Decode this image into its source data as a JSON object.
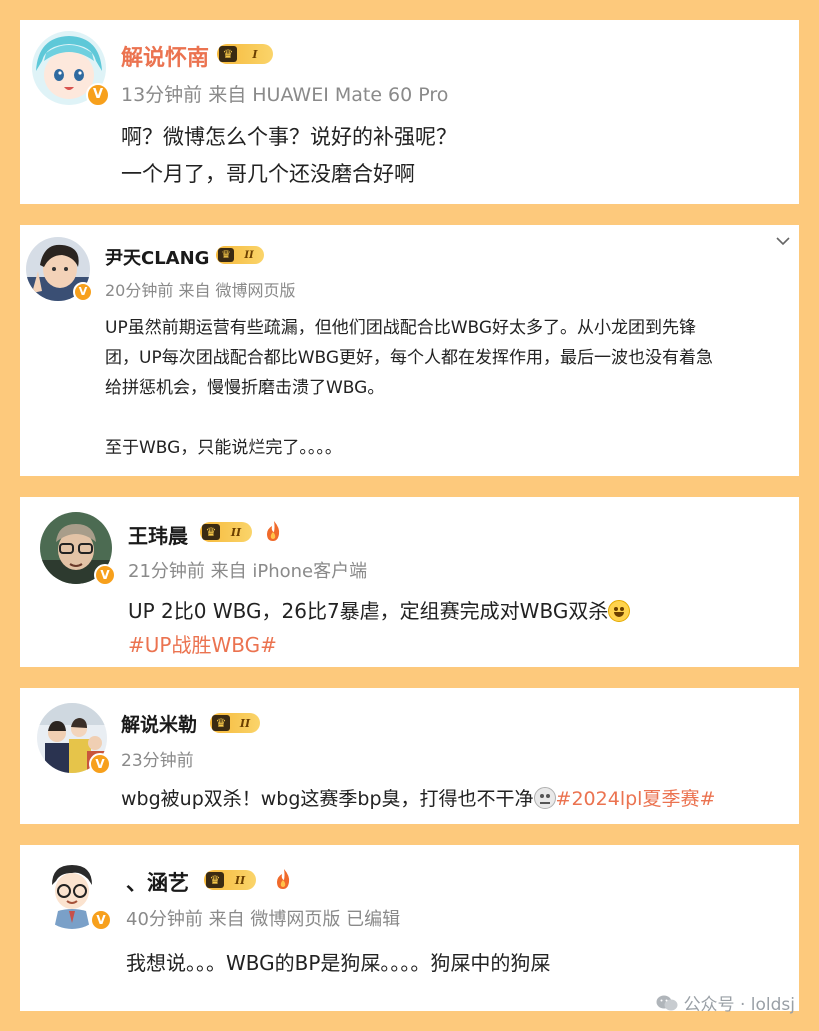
{
  "colors": {
    "background": "#fdc97c",
    "card": "#ffffff",
    "name_highlight": "#eb7350",
    "hashtag": "#eb7350",
    "meta": "#8a8a8a",
    "verified_badge": "#f7a01c"
  },
  "comments": [
    {
      "name": "解说怀南",
      "level_badge": "I",
      "meta": "13分钟前 来自 HUAWEI Mate 60 Pro",
      "lines": [
        "啊？微博怎么个事？说好的补强呢？",
        "一个月了，哥几个还没磨合好啊"
      ]
    },
    {
      "name": "尹天CLANG",
      "level_badge": "II",
      "meta": "20分钟前 来自 微博网页版",
      "lines": [
        "UP虽然前期运营有些疏漏，但他们团战配合比WBG好太多了。从小龙团到先锋",
        "团，UP每次团战配合都比WBG更好，每个人都在发挥作用，最后一波也没有着急",
        "给拼惩机会，慢慢折磨击溃了WBG。",
        "至于WBG，只能说烂完了。。。。"
      ],
      "collapse_icon": "chevron-down-icon"
    },
    {
      "name": "王玮晨",
      "level_badge": "II",
      "meta": "21分钟前 来自 iPhone客户端",
      "lines": [
        "UP 2比0 WBG，26比7暴虐，定组赛完成对WBG双杀"
      ],
      "hashtag": "#UP战胜WBG#"
    },
    {
      "name": "解说米勒",
      "level_badge": "II",
      "meta": "23分钟前",
      "line_prefix": "wbg被up双杀！wbg这赛季bp臭，打得也不干净",
      "hashtag": "#2024lpl夏季赛#"
    },
    {
      "name": "、涵艺",
      "level_badge": "II",
      "meta": "40分钟前 来自 微博网页版 已编辑",
      "lines": [
        "我想说。。。WBG的BP是狗屎。。。。狗屎中的狗屎"
      ]
    }
  ],
  "watermark": {
    "text": "公众号 · loldsj"
  }
}
